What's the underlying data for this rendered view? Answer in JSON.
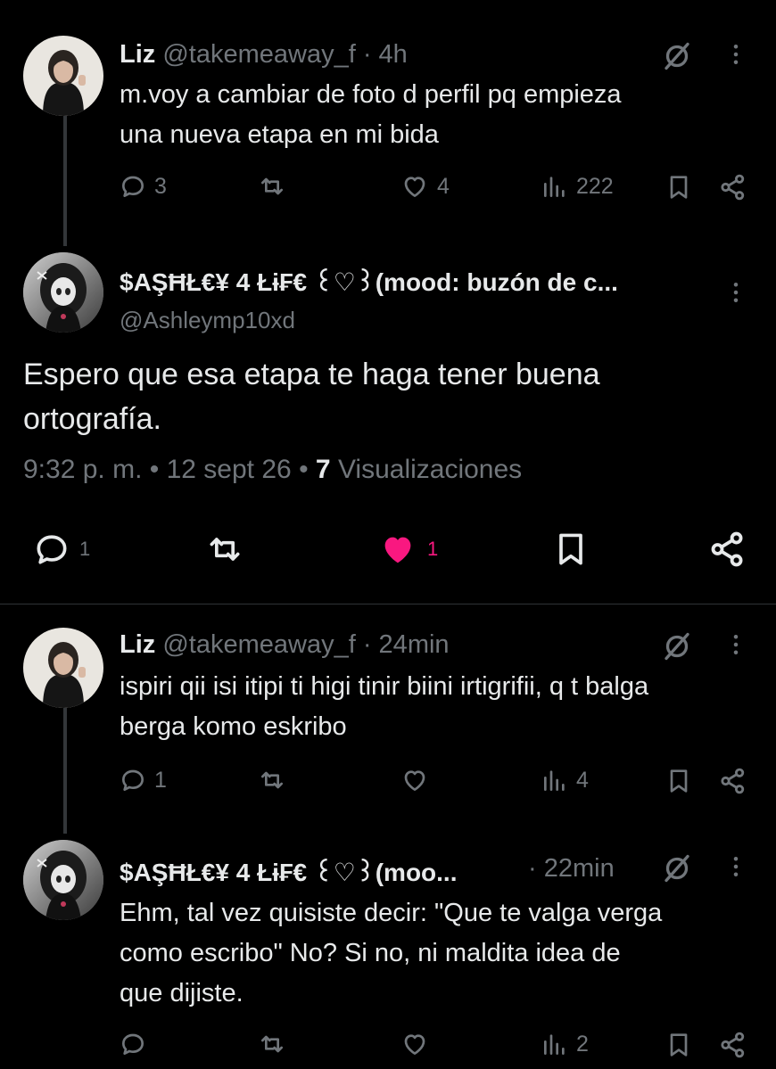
{
  "tweet1": {
    "name": "Liz",
    "handle": "@takemeaway_f",
    "time": "· 4h",
    "text_line1": "m.voy a cambiar de foto d perfil pq empieza",
    "text_line2": "una nueva etapa en mi bida",
    "replies": "3",
    "likes": "4",
    "views": "222"
  },
  "main": {
    "name": "$AŞĦŁ€¥ 4 Łɨ₣€ ꒰♡꒱(mood: buzón de c...",
    "handle": "@Ashleymp10xd",
    "text_line1": "Espero que esa etapa te haga tener buena",
    "text_line2": "ortografía.",
    "time": "9:32 p. m.",
    "date": "12 sept 26",
    "views_count": "7",
    "views_label": "Visualizaciones",
    "replies": "1",
    "likes": "1"
  },
  "tweet3": {
    "name": "Liz",
    "handle": "@takemeaway_f",
    "time": "· 24min",
    "text_line1": "ispiri qii isi itipi ti higi tinir biini irtigrifii, q t balga",
    "text_line2": "berga komo eskribo",
    "replies": "1",
    "views": "4"
  },
  "tweet4": {
    "name": "$AŞĦŁ€¥ 4 Łɨ₣€ ꒰♡꒱(moo...",
    "time": "· 22min",
    "text_line1": "Ehm, tal vez quisiste decir: \"Que te valga verga",
    "text_line2": "como escribo\" No? Si no, ni maldita idea de",
    "text_line3": "que dijiste.",
    "views": "2"
  },
  "colors": {
    "background": "#000000",
    "text": "#e7e9ea",
    "muted": "#71767b",
    "like_active": "#f91880",
    "divider": "#2f3336"
  },
  "icons": [
    "reply-icon",
    "retweet-icon",
    "like-icon",
    "views-icon",
    "bookmark-icon",
    "share-icon",
    "grok-icon",
    "more-icon"
  ]
}
